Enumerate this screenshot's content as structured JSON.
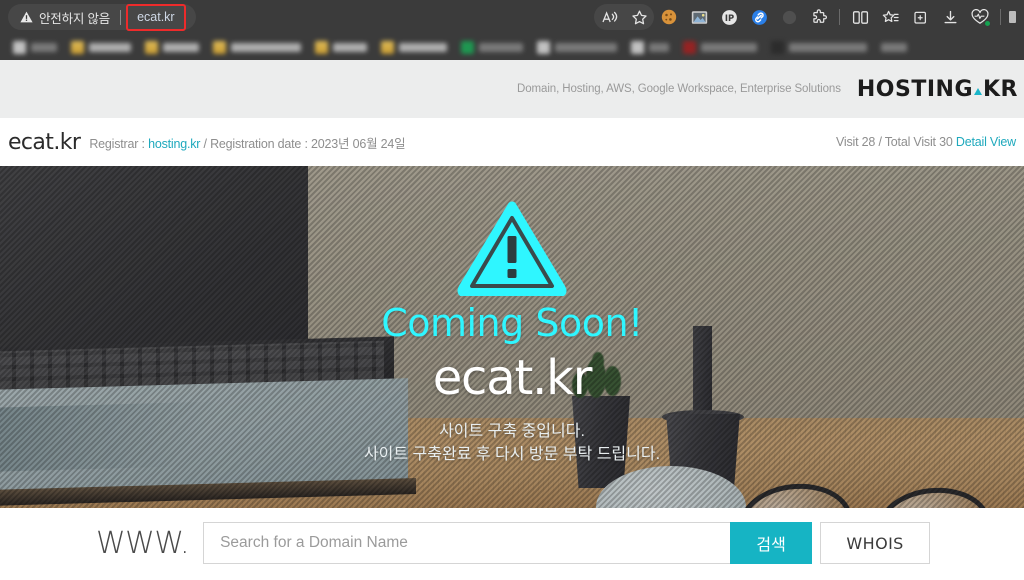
{
  "browser": {
    "security_label": "안전하지 않음",
    "url": "ecat.kr",
    "warning_icon": "warning-triangle-icon",
    "toolbar_icons": [
      {
        "name": "read-aloud-icon",
        "glyph": "A"
      },
      {
        "name": "favorite-star-icon",
        "glyph": "star"
      },
      {
        "name": "extension-cookie-icon",
        "glyph": "cookie"
      },
      {
        "name": "extension-screenshot-icon",
        "glyph": "image"
      },
      {
        "name": "extension-ip-icon",
        "glyph": "IP"
      },
      {
        "name": "extension-link-icon",
        "glyph": "link"
      },
      {
        "name": "extension-faded-icon",
        "glyph": "dot"
      },
      {
        "name": "extensions-puzzle-icon",
        "glyph": "puzzle"
      },
      {
        "name": "split-screen-icon",
        "glyph": "split"
      },
      {
        "name": "favorites-list-icon",
        "glyph": "fav-list"
      },
      {
        "name": "collections-icon",
        "glyph": "collections"
      },
      {
        "name": "downloads-icon",
        "glyph": "download"
      },
      {
        "name": "browser-essentials-icon",
        "glyph": "heart"
      }
    ],
    "bookmarks_note": "bookmark labels are blurred/redacted"
  },
  "site_header": {
    "tagline": "Domain, Hosting, AWS, Google Workspace, Enterprise Solutions",
    "brand_left": "HOSTING",
    "brand_right": "KR",
    "accent_color": "#19b5c9"
  },
  "info_bar": {
    "domain": "ecat.kr",
    "registrar_label": "Registrar : ",
    "registrar_value": "hosting.kr",
    "registration_label": " / Registration date : ",
    "registration_value": "2023년 06월 24일",
    "visits": "Visit 28 / Total Visit 30",
    "detail_view": "Detail View"
  },
  "hero": {
    "warning_icon": "warning-triangle-icon",
    "coming_soon": "Coming Soon!",
    "domain": "ecat.kr",
    "message_line1": "사이트 구축 중입니다.",
    "message_line2": "사이트 구축완료 후 다시 방문 부탁 드립니다.",
    "accent_color": "#2ff6ff"
  },
  "search": {
    "prefix": "WWW.",
    "placeholder": "Search for a Domain Name",
    "value": "",
    "search_button": "검색",
    "whois_button": "WHOIS",
    "button_color": "#16b4c4"
  }
}
